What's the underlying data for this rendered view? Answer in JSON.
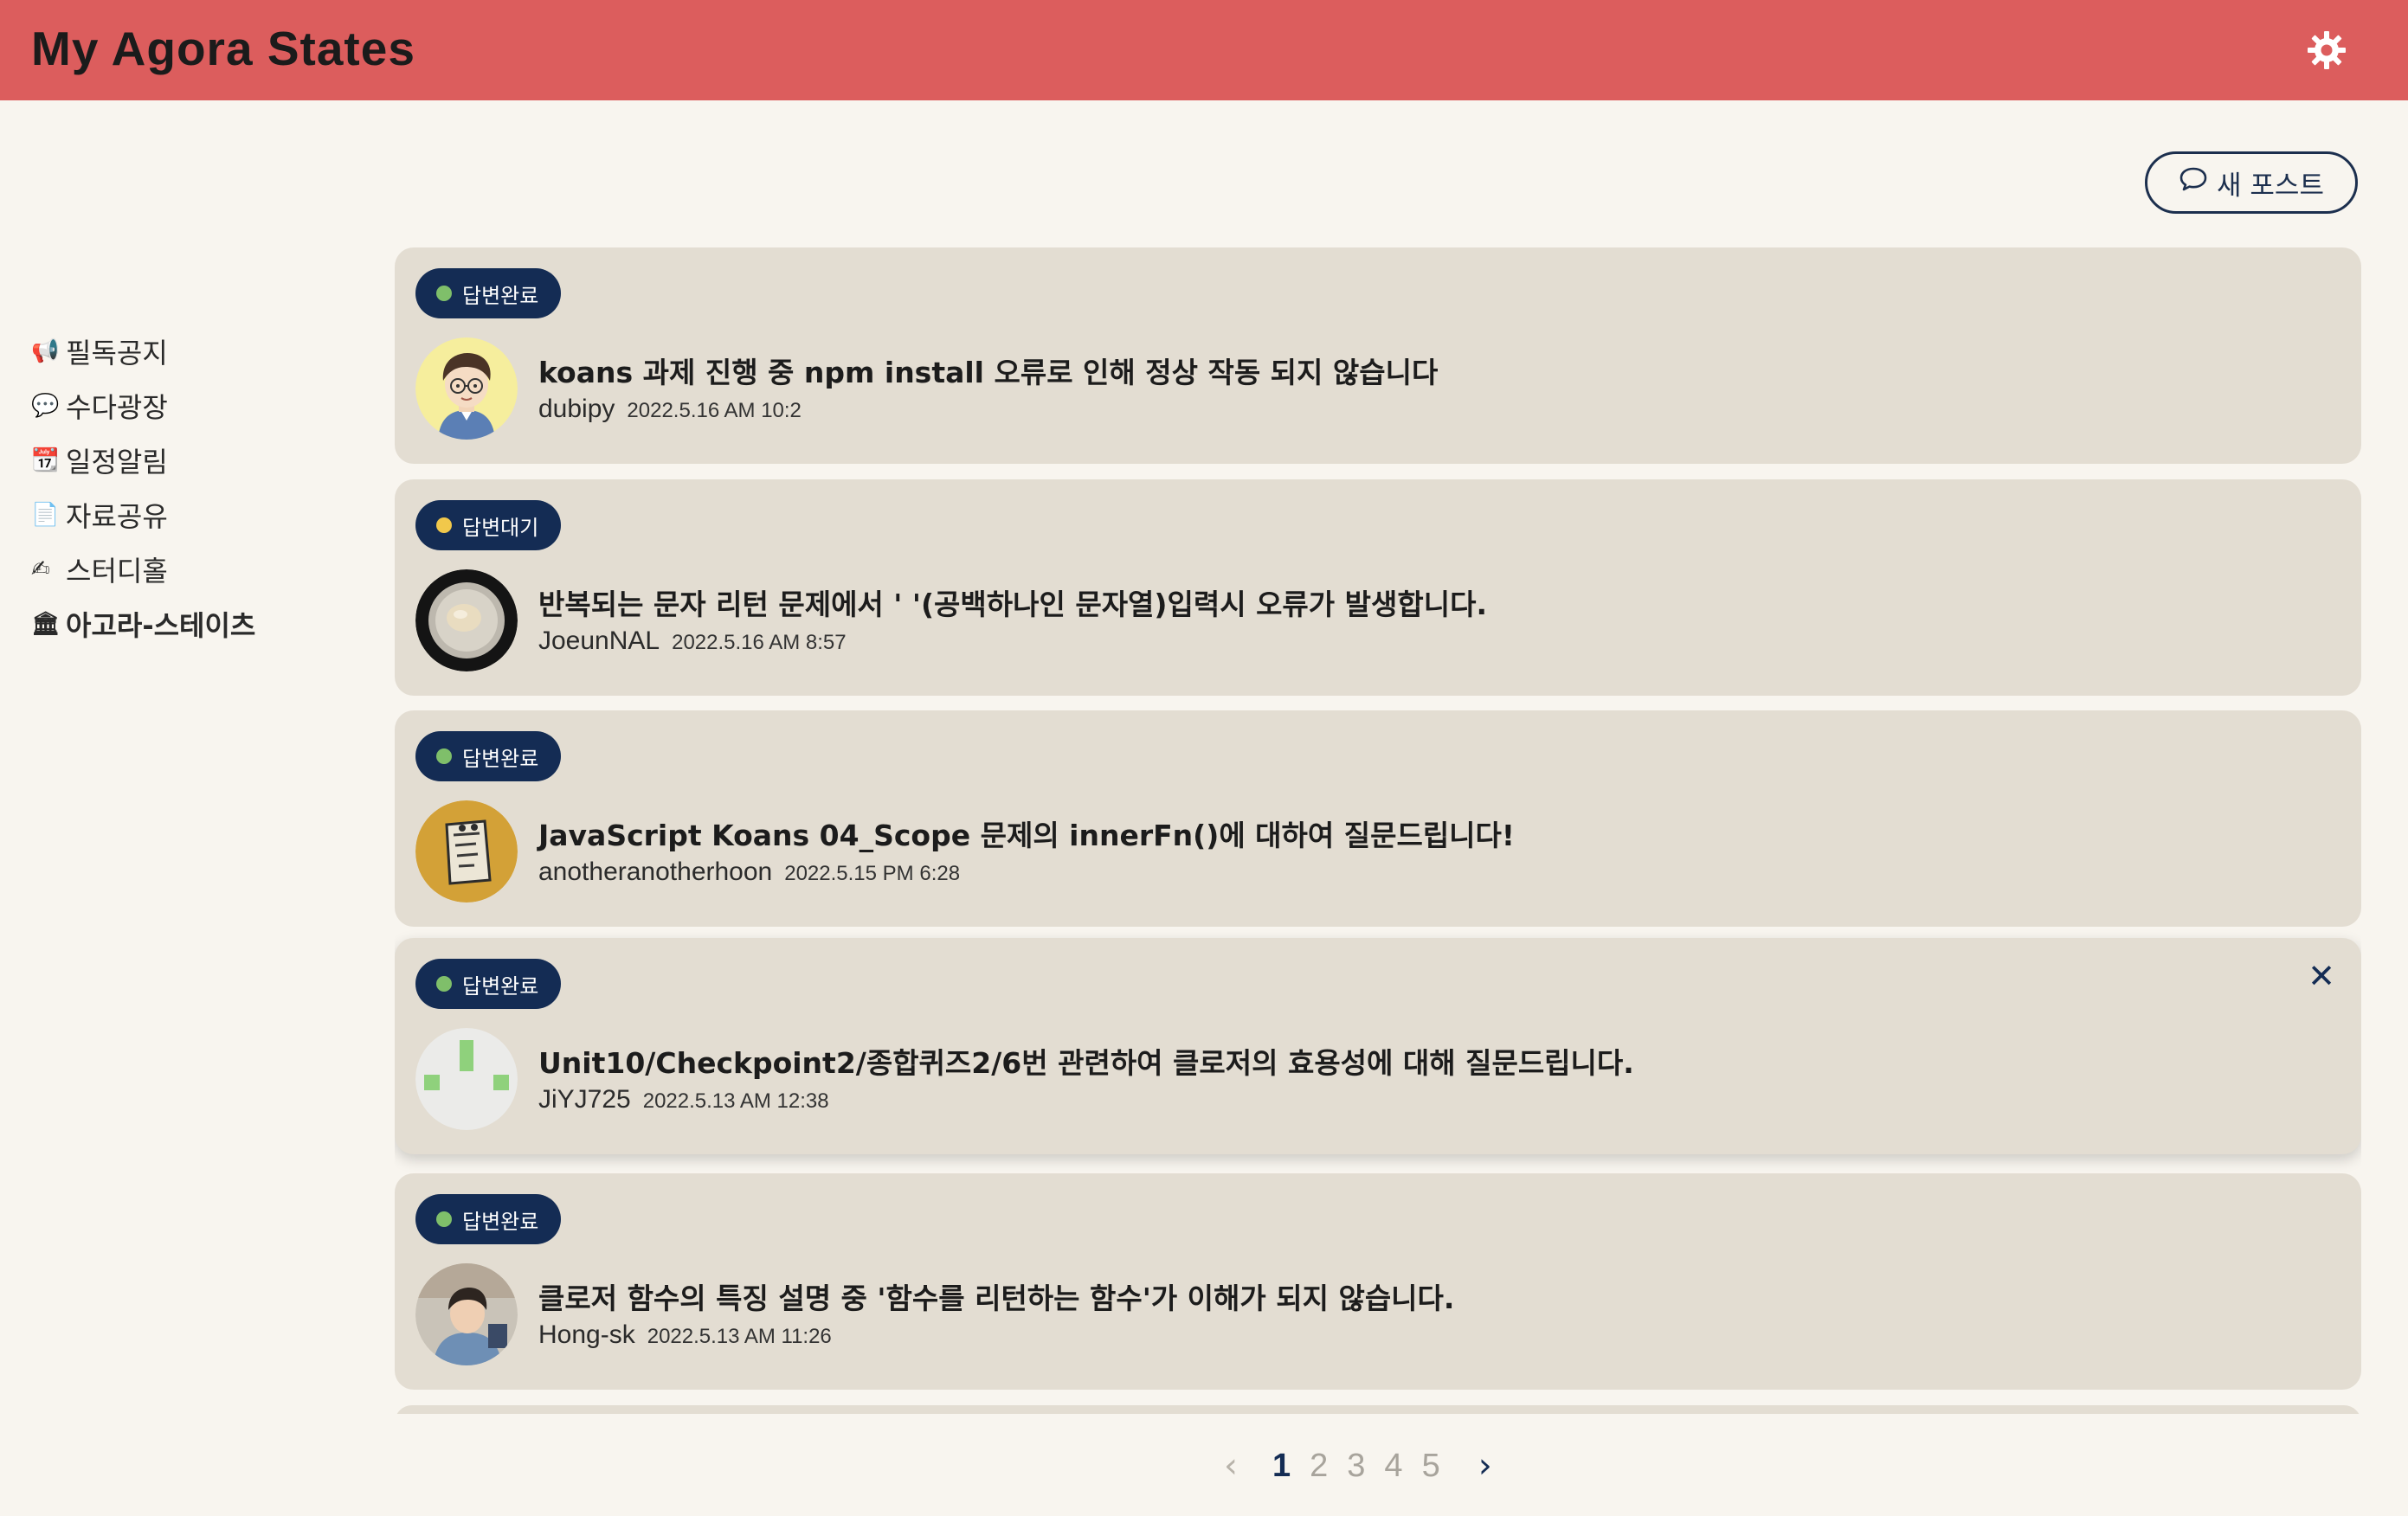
{
  "app": {
    "title": "My Agora States"
  },
  "toolbar": {
    "new_post_label": "새 포스트"
  },
  "sidebar": {
    "items": [
      {
        "icon": "📢",
        "label": "필독공지"
      },
      {
        "icon": "💬",
        "label": "수다광장"
      },
      {
        "icon": "📆",
        "label": "일정알림"
      },
      {
        "icon": "📄",
        "label": "자료공유"
      },
      {
        "icon": "✍",
        "label": "스터디홀"
      },
      {
        "icon": "🏛",
        "label": "아고라-스테이츠",
        "active": true
      }
    ]
  },
  "posts": [
    {
      "status": "답변완료",
      "status_color": "#7fbf6a",
      "title": "koans 과제 진행 중 npm install 오류로 인해 정상 작동 되지 않습니다",
      "author": "dubipy",
      "date": "2022.5.16 AM 10:2",
      "avatar_icon": "cartoon-boy-avatar"
    },
    {
      "status": "답변대기",
      "status_color": "#f1c84b",
      "title": "반복되는 문자 리턴 문제에서 ' '(공백하나인 문자열)입력시 오류가 발생합니다.",
      "author": "JoeunNAL",
      "date": "2022.5.16 AM 8:57",
      "avatar_icon": "bowl-photo-avatar"
    },
    {
      "status": "답변완료",
      "status_color": "#7fbf6a",
      "title": "JavaScript Koans 04_Scope 문제의 innerFn()에 대하여 질문드립니다!",
      "author": "anotheranotherhoon",
      "date": "2022.5.15 PM 6:28",
      "avatar_icon": "sticker-avatar"
    },
    {
      "status": "답변완료",
      "status_color": "#7fbf6a",
      "title": "Unit10/Checkpoint2/종합퀴즈2/6번 관련하여 클로저의 효용성에 대해 질문드립니다.",
      "author": "JiYJ725",
      "date": "2022.5.13 AM 12:38",
      "avatar_icon": "identicon-avatar"
    },
    {
      "status": "답변완료",
      "status_color": "#7fbf6a",
      "title": "클로저 함수의 특징 설명 중 '함수를 리턴하는 함수'가 이해가 되지 않습니다.",
      "author": "Hong-sk",
      "date": "2022.5.13 AM 11:26",
      "avatar_icon": "person-photo-avatar"
    }
  ],
  "pagination": {
    "prev": "‹",
    "next": "›",
    "pages": [
      "1",
      "2",
      "3",
      "4",
      "5"
    ],
    "current": "1"
  },
  "colors": {
    "header": "#dc5d5d",
    "accent": "#142c54",
    "card": "#e3ddd2",
    "background": "#f8f5ef"
  }
}
